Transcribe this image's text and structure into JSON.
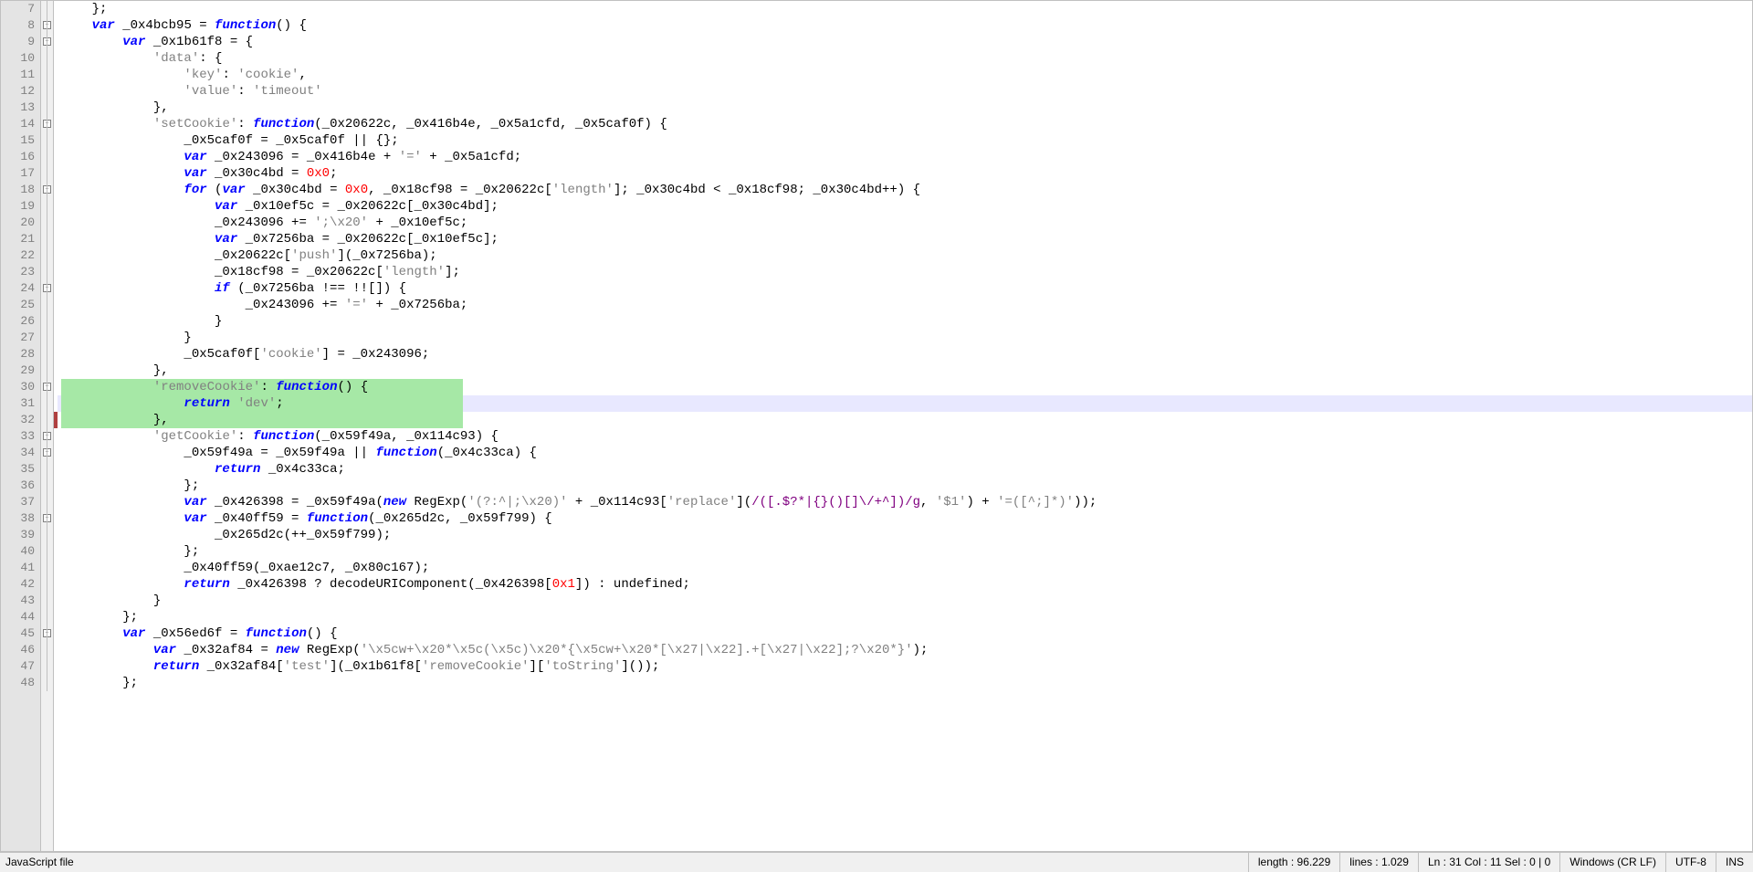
{
  "editor": {
    "first_line": 7,
    "highlighted_line": 31,
    "selection_start": 30,
    "selection_end": 32,
    "change_mark_line": 32,
    "fold_markers": [
      8,
      9,
      14,
      18,
      24,
      30,
      33,
      34,
      38,
      45
    ],
    "lines": [
      {
        "n": 7,
        "indent": "    ",
        "tokens": [
          {
            "t": "};",
            "c": "plain"
          }
        ]
      },
      {
        "n": 8,
        "indent": "    ",
        "tokens": [
          {
            "t": "var",
            "c": "kw"
          },
          {
            "t": " _0x4bcb95 = ",
            "c": "plain"
          },
          {
            "t": "function",
            "c": "kw"
          },
          {
            "t": "() {",
            "c": "plain"
          }
        ]
      },
      {
        "n": 9,
        "indent": "        ",
        "tokens": [
          {
            "t": "var",
            "c": "kw"
          },
          {
            "t": " _0x1b61f8 = {",
            "c": "plain"
          }
        ]
      },
      {
        "n": 10,
        "indent": "            ",
        "tokens": [
          {
            "t": "'data'",
            "c": "str"
          },
          {
            "t": ": {",
            "c": "plain"
          }
        ]
      },
      {
        "n": 11,
        "indent": "                ",
        "tokens": [
          {
            "t": "'key'",
            "c": "str"
          },
          {
            "t": ": ",
            "c": "plain"
          },
          {
            "t": "'cookie'",
            "c": "str"
          },
          {
            "t": ",",
            "c": "plain"
          }
        ]
      },
      {
        "n": 12,
        "indent": "                ",
        "tokens": [
          {
            "t": "'value'",
            "c": "str"
          },
          {
            "t": ": ",
            "c": "plain"
          },
          {
            "t": "'timeout'",
            "c": "str"
          }
        ]
      },
      {
        "n": 13,
        "indent": "            ",
        "tokens": [
          {
            "t": "},",
            "c": "plain"
          }
        ]
      },
      {
        "n": 14,
        "indent": "            ",
        "tokens": [
          {
            "t": "'setCookie'",
            "c": "str"
          },
          {
            "t": ": ",
            "c": "plain"
          },
          {
            "t": "function",
            "c": "kw"
          },
          {
            "t": "(_0x20622c, _0x416b4e, _0x5a1cfd, _0x5caf0f) {",
            "c": "plain"
          }
        ]
      },
      {
        "n": 15,
        "indent": "                ",
        "tokens": [
          {
            "t": "_0x5caf0f = _0x5caf0f || {};",
            "c": "plain"
          }
        ]
      },
      {
        "n": 16,
        "indent": "                ",
        "tokens": [
          {
            "t": "var",
            "c": "kw"
          },
          {
            "t": " _0x243096 = _0x416b4e + ",
            "c": "plain"
          },
          {
            "t": "'='",
            "c": "str"
          },
          {
            "t": " + _0x5a1cfd;",
            "c": "plain"
          }
        ]
      },
      {
        "n": 17,
        "indent": "                ",
        "tokens": [
          {
            "t": "var",
            "c": "kw"
          },
          {
            "t": " _0x30c4bd = ",
            "c": "plain"
          },
          {
            "t": "0x0",
            "c": "num"
          },
          {
            "t": ";",
            "c": "plain"
          }
        ]
      },
      {
        "n": 18,
        "indent": "                ",
        "tokens": [
          {
            "t": "for",
            "c": "kw"
          },
          {
            "t": " (",
            "c": "plain"
          },
          {
            "t": "var",
            "c": "kw"
          },
          {
            "t": " _0x30c4bd = ",
            "c": "plain"
          },
          {
            "t": "0x0",
            "c": "num"
          },
          {
            "t": ", _0x18cf98 = _0x20622c[",
            "c": "plain"
          },
          {
            "t": "'length'",
            "c": "str"
          },
          {
            "t": "]; _0x30c4bd < _0x18cf98; _0x30c4bd++) {",
            "c": "plain"
          }
        ]
      },
      {
        "n": 19,
        "indent": "                    ",
        "tokens": [
          {
            "t": "var",
            "c": "kw"
          },
          {
            "t": " _0x10ef5c = _0x20622c[_0x30c4bd];",
            "c": "plain"
          }
        ]
      },
      {
        "n": 20,
        "indent": "                    ",
        "tokens": [
          {
            "t": "_0x243096 += ",
            "c": "plain"
          },
          {
            "t": "';\\x20'",
            "c": "str"
          },
          {
            "t": " + _0x10ef5c;",
            "c": "plain"
          }
        ]
      },
      {
        "n": 21,
        "indent": "                    ",
        "tokens": [
          {
            "t": "var",
            "c": "kw"
          },
          {
            "t": " _0x7256ba = _0x20622c[_0x10ef5c];",
            "c": "plain"
          }
        ]
      },
      {
        "n": 22,
        "indent": "                    ",
        "tokens": [
          {
            "t": "_0x20622c[",
            "c": "plain"
          },
          {
            "t": "'push'",
            "c": "str"
          },
          {
            "t": "](_0x7256ba);",
            "c": "plain"
          }
        ]
      },
      {
        "n": 23,
        "indent": "                    ",
        "tokens": [
          {
            "t": "_0x18cf98 = _0x20622c[",
            "c": "plain"
          },
          {
            "t": "'length'",
            "c": "str"
          },
          {
            "t": "];",
            "c": "plain"
          }
        ]
      },
      {
        "n": 24,
        "indent": "                    ",
        "tokens": [
          {
            "t": "if",
            "c": "kw"
          },
          {
            "t": " (_0x7256ba !== !![]) {",
            "c": "plain"
          }
        ]
      },
      {
        "n": 25,
        "indent": "                        ",
        "tokens": [
          {
            "t": "_0x243096 += ",
            "c": "plain"
          },
          {
            "t": "'='",
            "c": "str"
          },
          {
            "t": " + _0x7256ba;",
            "c": "plain"
          }
        ]
      },
      {
        "n": 26,
        "indent": "                    ",
        "tokens": [
          {
            "t": "}",
            "c": "plain"
          }
        ]
      },
      {
        "n": 27,
        "indent": "                ",
        "tokens": [
          {
            "t": "}",
            "c": "plain"
          }
        ]
      },
      {
        "n": 28,
        "indent": "                ",
        "tokens": [
          {
            "t": "_0x5caf0f[",
            "c": "plain"
          },
          {
            "t": "'cookie'",
            "c": "str"
          },
          {
            "t": "] = _0x243096;",
            "c": "plain"
          }
        ]
      },
      {
        "n": 29,
        "indent": "            ",
        "tokens": [
          {
            "t": "},",
            "c": "plain"
          }
        ]
      },
      {
        "n": 30,
        "indent": "            ",
        "tokens": [
          {
            "t": "'removeCookie'",
            "c": "str"
          },
          {
            "t": ": ",
            "c": "plain"
          },
          {
            "t": "function",
            "c": "kw"
          },
          {
            "t": "() {",
            "c": "plain"
          }
        ]
      },
      {
        "n": 31,
        "indent": "                ",
        "tokens": [
          {
            "t": "return",
            "c": "kw"
          },
          {
            "t": " ",
            "c": "plain"
          },
          {
            "t": "'dev'",
            "c": "str"
          },
          {
            "t": ";",
            "c": "plain"
          }
        ]
      },
      {
        "n": 32,
        "indent": "            ",
        "tokens": [
          {
            "t": "},",
            "c": "plain"
          }
        ]
      },
      {
        "n": 33,
        "indent": "            ",
        "tokens": [
          {
            "t": "'getCookie'",
            "c": "str"
          },
          {
            "t": ": ",
            "c": "plain"
          },
          {
            "t": "function",
            "c": "kw"
          },
          {
            "t": "(_0x59f49a, _0x114c93) {",
            "c": "plain"
          }
        ]
      },
      {
        "n": 34,
        "indent": "                ",
        "tokens": [
          {
            "t": "_0x59f49a = _0x59f49a || ",
            "c": "plain"
          },
          {
            "t": "function",
            "c": "kw"
          },
          {
            "t": "(_0x4c33ca) {",
            "c": "plain"
          }
        ]
      },
      {
        "n": 35,
        "indent": "                    ",
        "tokens": [
          {
            "t": "return",
            "c": "kw"
          },
          {
            "t": " _0x4c33ca;",
            "c": "plain"
          }
        ]
      },
      {
        "n": 36,
        "indent": "                ",
        "tokens": [
          {
            "t": "};",
            "c": "plain"
          }
        ]
      },
      {
        "n": 37,
        "indent": "                ",
        "tokens": [
          {
            "t": "var",
            "c": "kw"
          },
          {
            "t": " _0x426398 = _0x59f49a(",
            "c": "plain"
          },
          {
            "t": "new",
            "c": "kw"
          },
          {
            "t": " RegExp(",
            "c": "plain"
          },
          {
            "t": "'(?:^|;\\x20)'",
            "c": "str"
          },
          {
            "t": " + _0x114c93[",
            "c": "plain"
          },
          {
            "t": "'replace'",
            "c": "str"
          },
          {
            "t": "](",
            "c": "plain"
          },
          {
            "t": "/([.$?*|{}()[]\\/+^])/g",
            "c": "regex"
          },
          {
            "t": ", ",
            "c": "plain"
          },
          {
            "t": "'$1'",
            "c": "str"
          },
          {
            "t": ") + ",
            "c": "plain"
          },
          {
            "t": "'=([^;]*)'",
            "c": "str"
          },
          {
            "t": "));",
            "c": "plain"
          }
        ]
      },
      {
        "n": 38,
        "indent": "                ",
        "tokens": [
          {
            "t": "var",
            "c": "kw"
          },
          {
            "t": " _0x40ff59 = ",
            "c": "plain"
          },
          {
            "t": "function",
            "c": "kw"
          },
          {
            "t": "(_0x265d2c, _0x59f799) {",
            "c": "plain"
          }
        ]
      },
      {
        "n": 39,
        "indent": "                    ",
        "tokens": [
          {
            "t": "_0x265d2c(++_0x59f799);",
            "c": "plain"
          }
        ]
      },
      {
        "n": 40,
        "indent": "                ",
        "tokens": [
          {
            "t": "};",
            "c": "plain"
          }
        ]
      },
      {
        "n": 41,
        "indent": "                ",
        "tokens": [
          {
            "t": "_0x40ff59(_0xae12c7, _0x80c167);",
            "c": "plain"
          }
        ]
      },
      {
        "n": 42,
        "indent": "                ",
        "tokens": [
          {
            "t": "return",
            "c": "kw"
          },
          {
            "t": " _0x426398 ? decodeURIComponent(_0x426398[",
            "c": "plain"
          },
          {
            "t": "0x1",
            "c": "num"
          },
          {
            "t": "]) : undefined;",
            "c": "plain"
          }
        ]
      },
      {
        "n": 43,
        "indent": "            ",
        "tokens": [
          {
            "t": "}",
            "c": "plain"
          }
        ]
      },
      {
        "n": 44,
        "indent": "        ",
        "tokens": [
          {
            "t": "};",
            "c": "plain"
          }
        ]
      },
      {
        "n": 45,
        "indent": "        ",
        "tokens": [
          {
            "t": "var",
            "c": "kw"
          },
          {
            "t": " _0x56ed6f = ",
            "c": "plain"
          },
          {
            "t": "function",
            "c": "kw"
          },
          {
            "t": "() {",
            "c": "plain"
          }
        ]
      },
      {
        "n": 46,
        "indent": "            ",
        "tokens": [
          {
            "t": "var",
            "c": "kw"
          },
          {
            "t": " _0x32af84 = ",
            "c": "plain"
          },
          {
            "t": "new",
            "c": "kw"
          },
          {
            "t": " RegExp(",
            "c": "plain"
          },
          {
            "t": "'\\x5cw+\\x20*\\x5c(\\x5c)\\x20*{\\x5cw+\\x20*[\\x27|\\x22].+[\\x27|\\x22];?\\x20*}'",
            "c": "str"
          },
          {
            "t": ");",
            "c": "plain"
          }
        ]
      },
      {
        "n": 47,
        "indent": "            ",
        "tokens": [
          {
            "t": "return",
            "c": "kw"
          },
          {
            "t": " _0x32af84[",
            "c": "plain"
          },
          {
            "t": "'test'",
            "c": "str"
          },
          {
            "t": "](_0x1b61f8[",
            "c": "plain"
          },
          {
            "t": "'removeCookie'",
            "c": "str"
          },
          {
            "t": "][",
            "c": "plain"
          },
          {
            "t": "'toString'",
            "c": "str"
          },
          {
            "t": "]());",
            "c": "plain"
          }
        ]
      },
      {
        "n": 48,
        "indent": "        ",
        "tokens": [
          {
            "t": "};",
            "c": "plain"
          }
        ]
      }
    ]
  },
  "status": {
    "file_type": "JavaScript file",
    "length_label": "length : 96.229",
    "lines_label": "lines : 1.029",
    "position": "Ln : 31    Col : 11    Sel : 0 | 0",
    "eol": "Windows (CR LF)",
    "encoding": "UTF-8",
    "mode": "INS"
  }
}
